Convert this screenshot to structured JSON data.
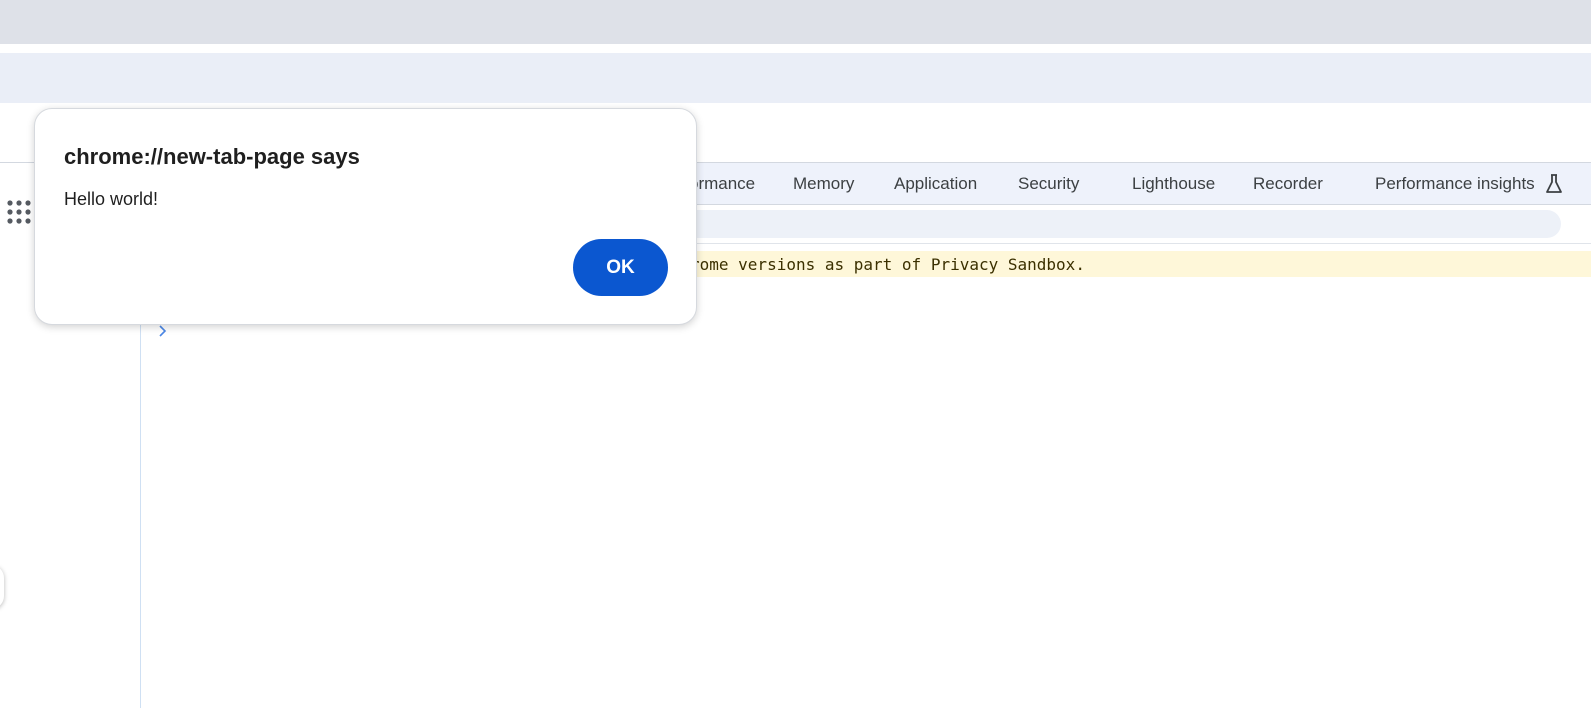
{
  "dialog": {
    "title": "chrome://new-tab-page says",
    "message": "Hello world!",
    "ok_label": "OK"
  },
  "devtools": {
    "tabs": [
      {
        "label": "ormance"
      },
      {
        "label": "Memory"
      },
      {
        "label": "Application"
      },
      {
        "label": "Security"
      },
      {
        "label": "Lighthouse"
      },
      {
        "label": "Recorder"
      },
      {
        "label": "Performance insights"
      }
    ],
    "experimental_icon": "flask-icon",
    "console": {
      "warning_text": "rome versions as part of Privacy Sandbox.",
      "prompt_icon": "chevron-right-icon"
    }
  },
  "sidebar": {
    "handle_icon": "grip-dots-icon"
  },
  "colors": {
    "accent": "#0b57d0",
    "warning_bg": "#fef7d9",
    "tab_bar_bg": "#eef2fb",
    "tabstrip_bg": "#dee1e8",
    "toolbar_bg": "#eaeef7"
  }
}
